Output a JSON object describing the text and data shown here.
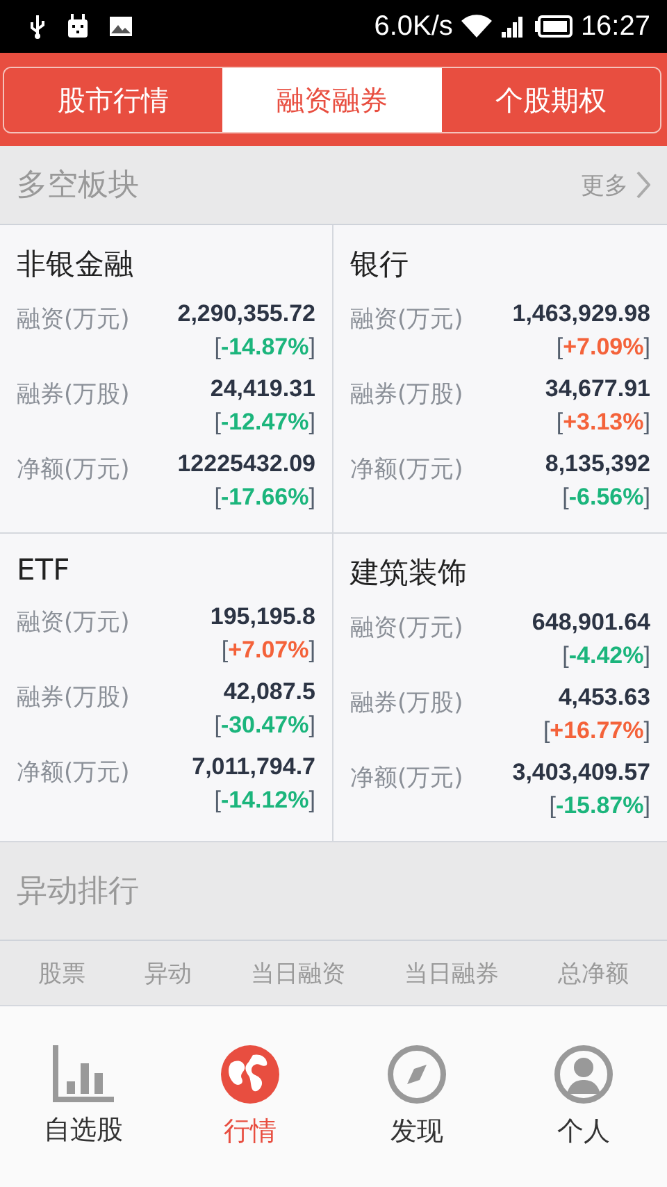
{
  "status_bar": {
    "speed": "6.0K/s",
    "time": "16:27"
  },
  "tabs": [
    {
      "label": "股市行情",
      "selected": false
    },
    {
      "label": "融资融券",
      "selected": true
    },
    {
      "label": "个股期权",
      "selected": false
    }
  ],
  "section": {
    "title": "多空板块",
    "more": "更多"
  },
  "sectors": [
    {
      "name": "非银金融",
      "rows": [
        {
          "label": "融资(万元)",
          "value": "2,290,355.72",
          "change": "[-14.87%]",
          "color": "#1bb57c"
        },
        {
          "label": "融券(万股)",
          "value": "24,419.31",
          "change": "[-12.47%]",
          "color": "#1bb57c"
        },
        {
          "label": "净额(万元)",
          "value": "12225432.09",
          "change": "[-17.66%]",
          "color": "#1bb57c"
        }
      ]
    },
    {
      "name": "银行",
      "rows": [
        {
          "label": "融资(万元)",
          "value": "1,463,929.98",
          "change": "[+7.09%]",
          "color": "#f4623a"
        },
        {
          "label": "融券(万股)",
          "value": "34,677.91",
          "change": "[+3.13%]",
          "color": "#f4623a"
        },
        {
          "label": "净额(万元)",
          "value": "8,135,392",
          "change": "[-6.56%]",
          "color": "#1bb57c"
        }
      ]
    },
    {
      "name": "ETF",
      "rows": [
        {
          "label": "融资(万元)",
          "value": "195,195.8",
          "change": "[+7.07%]",
          "color": "#f4623a"
        },
        {
          "label": "融券(万股)",
          "value": "42,087.5",
          "change": "[-30.47%]",
          "color": "#1bb57c"
        },
        {
          "label": "净额(万元)",
          "value": "7,011,794.7",
          "change": "[-14.12%]",
          "color": "#1bb57c"
        }
      ]
    },
    {
      "name": "建筑装饰",
      "rows": [
        {
          "label": "融资(万元)",
          "value": "648,901.64",
          "change": "[-4.42%]",
          "color": "#1bb57c"
        },
        {
          "label": "融券(万股)",
          "value": "4,453.63",
          "change": "[+16.77%]",
          "color": "#f4623a"
        },
        {
          "label": "净额(万元)",
          "value": "3,403,409.57",
          "change": "[-15.87%]",
          "color": "#1bb57c"
        }
      ]
    }
  ],
  "ranking": {
    "title": "异动排行",
    "columns": [
      "股票",
      "异动",
      "当日融资",
      "当日融券",
      "总净额"
    ]
  },
  "nav": [
    {
      "label": "自选股",
      "kind": "chart",
      "selected": false
    },
    {
      "label": "行情",
      "kind": "globe",
      "selected": true
    },
    {
      "label": "发现",
      "kind": "compass",
      "selected": false
    },
    {
      "label": "个人",
      "kind": "person",
      "selected": false
    }
  ]
}
